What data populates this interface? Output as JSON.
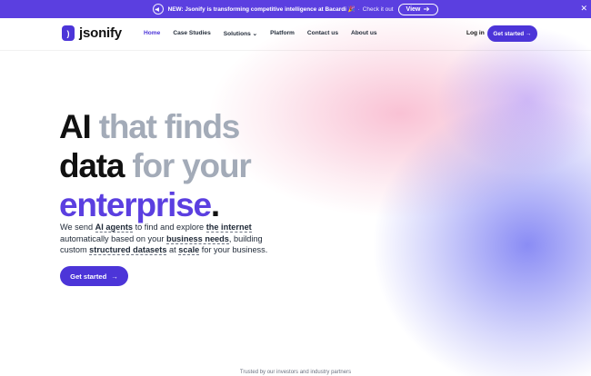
{
  "announcement": {
    "icon": "megaphone-icon",
    "message": "NEW: Jsonify is transforming competitive intelligence at Bacardi 🎉",
    "separator": "·",
    "check_text": "Check it out",
    "button_label": "View",
    "button_icon": "arrow-right-icon",
    "close_icon": "close-icon",
    "color": "#5b3fe0"
  },
  "nav": {
    "logo_mark": ")",
    "logo_text": "jsonify",
    "items": [
      {
        "label": "Home",
        "active": true
      },
      {
        "label": "Case Studies",
        "active": false
      },
      {
        "label": "Solutions",
        "active": false,
        "dropdown": true
      },
      {
        "label": "Platform",
        "active": false
      },
      {
        "label": "Contact us",
        "active": false
      },
      {
        "label": "About us",
        "active": false
      }
    ],
    "dropdown_icon": "⌄",
    "login": "Log in",
    "cta": "Get started",
    "cta_icon": "→"
  },
  "hero": {
    "line1_a": "AI",
    "line1_b": "that finds",
    "line2_a": "data",
    "line2_b": "for your",
    "line3_a": "enterprise",
    "line3_b": ".",
    "sub": {
      "l1_a": "We send ",
      "l1_b": "AI agents",
      "l1_c": " to find and explore ",
      "l1_d": "the internet",
      "l2_a": "automatically based on your ",
      "l2_b": "business needs",
      "l2_c": ", building",
      "l3_a": "custom ",
      "l3_b": "structured datasets",
      "l3_c": " at ",
      "l3_d": "scale",
      "l3_e": " for your business."
    },
    "cta": "Get started",
    "cta_icon": "→"
  },
  "trusted_text": "Trusted by our investors and industry partners",
  "colors": {
    "brand": "#4c35d8",
    "accent_purple": "#5b3fe0",
    "muted_gray": "#a3abb8"
  }
}
